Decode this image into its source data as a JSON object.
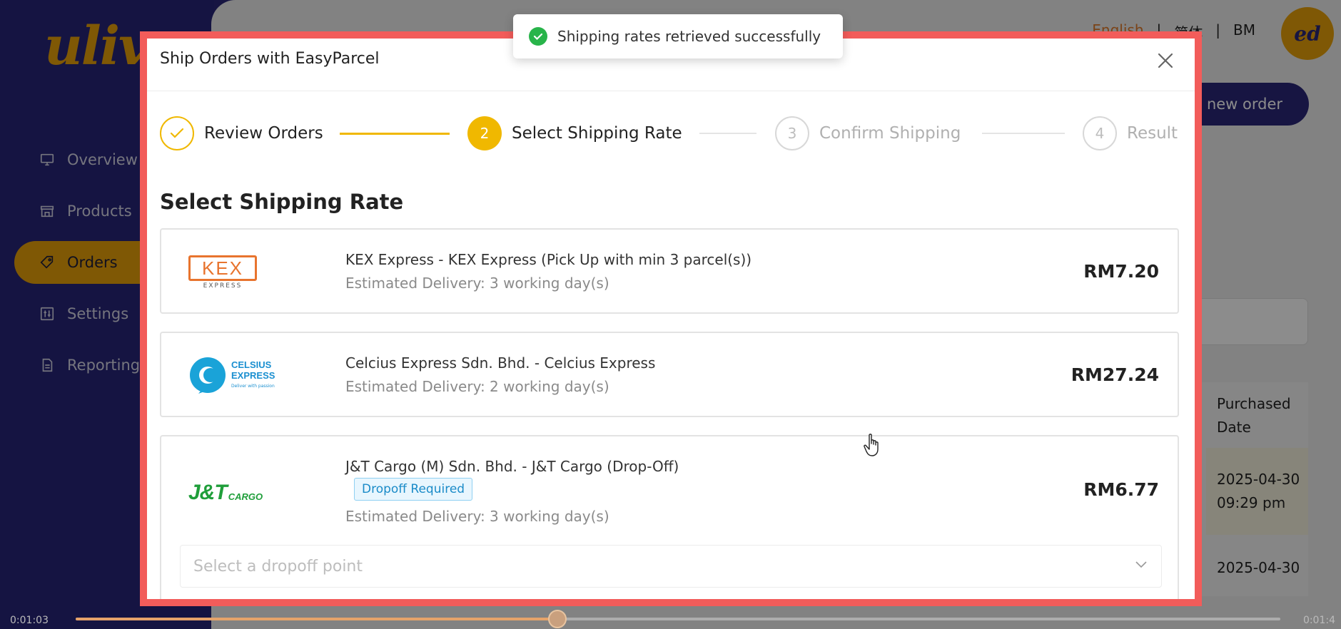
{
  "app": {
    "logo_text": "ulive",
    "sidebar": [
      {
        "label": "Overview",
        "icon": "monitor-icon"
      },
      {
        "label": "Products",
        "icon": "store-icon"
      },
      {
        "label": "Orders",
        "icon": "tag-icon",
        "active": true
      },
      {
        "label": "Settings",
        "icon": "sliders-icon"
      },
      {
        "label": "Reporting",
        "icon": "document-icon"
      }
    ],
    "topbar": {
      "lang_en": "English",
      "lang_zh": "简体",
      "sep": "|",
      "lang_bm": "BM",
      "avatar_initials": "ed"
    },
    "new_order_label": "new order",
    "table": {
      "purchased_header_line1": "Purchased",
      "purchased_header_line2": "Date",
      "rows": [
        {
          "date": "2025-04-30",
          "time": "09:29 pm"
        },
        {
          "date": "2025-04-30",
          "time": ""
        }
      ]
    }
  },
  "toast": {
    "text": "Shipping rates retrieved successfully",
    "color": "#28b44a"
  },
  "modal": {
    "title": "Ship Orders with EasyParcel",
    "steps": [
      {
        "number": "1",
        "label": "Review Orders",
        "state": "done"
      },
      {
        "number": "2",
        "label": "Select Shipping Rate",
        "state": "current"
      },
      {
        "number": "3",
        "label": "Confirm Shipping",
        "state": "pending"
      },
      {
        "number": "4",
        "label": "Result",
        "state": "pending"
      }
    ],
    "section_title": "Select Shipping Rate",
    "rates": [
      {
        "carrier": "KEX Express",
        "logo_text": "KEX",
        "logo_sub": "EXPRESS",
        "name": "KEX Express - KEX Express (Pick Up with min 3 parcel(s))",
        "eta": "Estimated Delivery: 3 working day(s)",
        "price": "RM7.20"
      },
      {
        "carrier": "Celsius Express",
        "logo_text1": "CELSIUS",
        "logo_text2": "EXPRESS",
        "logo_tagline": "Deliver with passion",
        "name": "Celcius Express Sdn. Bhd. - Celcius Express",
        "eta": "Estimated Delivery: 2 working day(s)",
        "price": "RM27.24"
      },
      {
        "carrier": "J&T Cargo",
        "logo_text": "J&T",
        "logo_sub": "CARGO",
        "name": "J&T Cargo (M) Sdn. Bhd. - J&T Cargo (Drop-Off)",
        "badge": "Dropoff Required",
        "eta": "Estimated Delivery: 3 working day(s)",
        "price": "RM6.77",
        "dropoff_placeholder": "Select a dropoff point"
      }
    ]
  },
  "video": {
    "current_time": "0:01:03",
    "total_time": "0:01:4",
    "progress": 0.4
  }
}
